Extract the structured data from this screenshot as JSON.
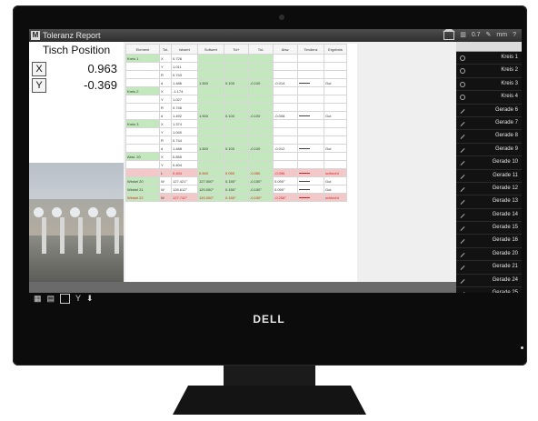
{
  "window": {
    "title": "Toleranz Report",
    "status_num": "0.7",
    "unit": "mm",
    "help": "?"
  },
  "position": {
    "title": "Tisch Position",
    "x_label": "X",
    "x_value": "0.963",
    "y_label": "Y",
    "y_value": "-0.369"
  },
  "table": {
    "headers": [
      "Element",
      "Tol.",
      "Istwert",
      "Sollwert",
      "Tol+",
      "Tol-",
      "Abw.",
      "Tendenz",
      "Ergebnis"
    ],
    "groups": [
      {
        "name": "Kreis 1",
        "rows": [
          {
            "axis": "X",
            "ist": "0.728"
          },
          {
            "axis": "Y",
            "ist": "1.011"
          },
          {
            "axis": "R",
            "ist": "0.743"
          },
          {
            "axis": "d",
            "ist": "1.486",
            "soll": "1.500",
            "tolp": "0.100",
            "tolm": "-0.100",
            "abw": "-0.014",
            "erg": "Gut"
          }
        ]
      },
      {
        "name": "Kreis 2",
        "rows": [
          {
            "axis": "X",
            "ist": "-1.174"
          },
          {
            "axis": "Y",
            "ist": "1.027"
          },
          {
            "axis": "R",
            "ist": "0.746"
          },
          {
            "axis": "d",
            "ist": "1.492",
            "soll": "1.500",
            "tolp": "0.100",
            "tolm": "-0.100",
            "abw": "-0.008",
            "erg": "Gut"
          }
        ]
      },
      {
        "name": "Kreis 3",
        "rows": [
          {
            "axis": "X",
            "ist": "1.374"
          },
          {
            "axis": "Y",
            "ist": "1.040"
          },
          {
            "axis": "R",
            "ist": "0.744"
          },
          {
            "axis": "d",
            "ist": "1.488",
            "soll": "1.500",
            "tolp": "0.100",
            "tolm": "-0.100",
            "abw": "-0.012",
            "erg": "Gut"
          }
        ]
      },
      {
        "name": "Abst. 20",
        "rows": [
          {
            "axis": "X",
            "ist": "0.855"
          },
          {
            "axis": "Y",
            "ist": "0.404"
          },
          {
            "axis": "L",
            "ist": "0.404",
            "soll": "0.500",
            "tolp": "0.050",
            "tolm": "-0.050",
            "abw": "-0.096",
            "erg": "schlecht"
          }
        ]
      }
    ],
    "angles": [
      {
        "name": "Winkel 20",
        "axis": "W",
        "ist": "127.421°",
        "soll": "127.000°",
        "tolp": "0.150°",
        "tolm": "-0.150°",
        "abw": "0.090°",
        "erg": "Gut"
      },
      {
        "name": "Winkel 21",
        "axis": "W",
        "ist": "126.612°",
        "soll": "120.000°",
        "tolp": "0.150°",
        "tolm": "-0.150°",
        "abw": "0.090°",
        "erg": "Gut"
      },
      {
        "name": "Winkel 22",
        "axis": "W",
        "ist": "127.742°",
        "soll": "120.000°",
        "tolp": "0.150°",
        "tolm": "-0.150°",
        "abw": "-0.258°",
        "erg": "schlecht"
      }
    ]
  },
  "features": [
    {
      "label": "Kreis 1",
      "icon": "circle-icon"
    },
    {
      "label": "Kreis 2",
      "icon": "circle-icon"
    },
    {
      "label": "Kreis 3",
      "icon": "circle-icon"
    },
    {
      "label": "Kreis 4",
      "icon": "circle-icon"
    },
    {
      "label": "Gerade 6",
      "icon": "line-icon"
    },
    {
      "label": "Gerade 7",
      "icon": "line-icon"
    },
    {
      "label": "Gerade 8",
      "icon": "line-icon"
    },
    {
      "label": "Gerade 9",
      "icon": "line-icon"
    },
    {
      "label": "Gerade 10",
      "icon": "line-icon"
    },
    {
      "label": "Gerade 11",
      "icon": "line-icon"
    },
    {
      "label": "Gerade 12",
      "icon": "line-icon"
    },
    {
      "label": "Gerade 13",
      "icon": "line-icon"
    },
    {
      "label": "Gerade 14",
      "icon": "line-icon"
    },
    {
      "label": "Gerade 15",
      "icon": "line-icon"
    },
    {
      "label": "Gerade 16",
      "icon": "line-icon"
    },
    {
      "label": "Gerade 20",
      "icon": "line-icon"
    },
    {
      "label": "Gerade 21",
      "icon": "line-icon"
    },
    {
      "label": "Gerade 24",
      "icon": "line-icon"
    },
    {
      "label": "Gerade 25",
      "icon": "line-icon"
    }
  ],
  "monitor": {
    "brand": "DELL"
  },
  "colors": {
    "pass_green": "#c3e8bd",
    "fail_red": "#d42020"
  }
}
